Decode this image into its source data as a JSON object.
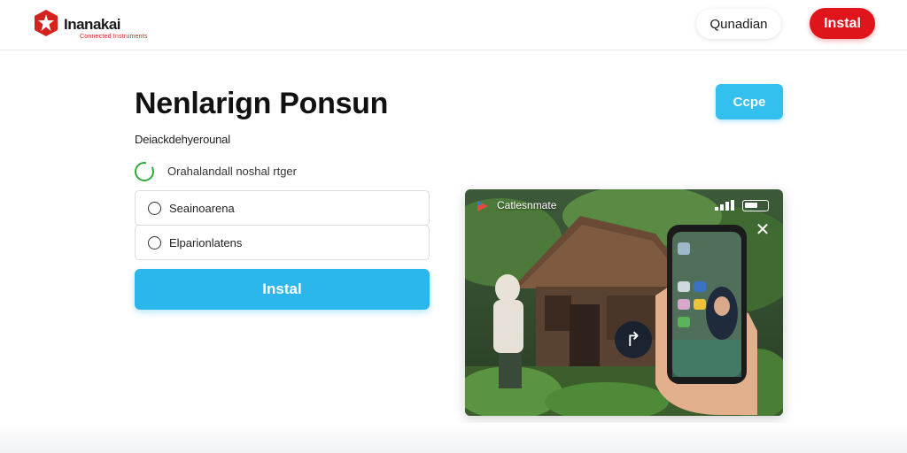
{
  "header": {
    "logo_text": "Inanakai",
    "logo_subtext": "Connected Instruments",
    "nav_link": "Qunadian",
    "install_label": "Instal",
    "accent": "#e0151b"
  },
  "main": {
    "title": "Nenlarign Ponsun",
    "subtitle": "Deiackdehyerounal",
    "copy_label": "Ccpe",
    "status_text": "Orahalandall noshal rtger",
    "status_color": "#2eaa3a",
    "options": [
      {
        "label": "Seainoarena"
      },
      {
        "label": "Elparionlatens"
      }
    ],
    "install_label": "Instal",
    "install_color": "#2bb7ec"
  },
  "media": {
    "brand": "Catlesnmate",
    "icons": {
      "brand": "brand-logo-icon",
      "signal": "signal-icon",
      "battery": "battery-icon",
      "close": "close-icon",
      "play": "play-icon"
    }
  }
}
